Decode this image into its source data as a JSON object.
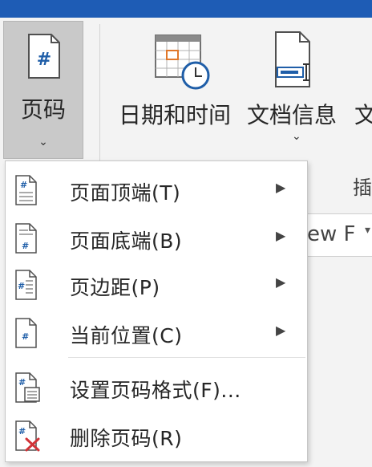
{
  "ribbon": {
    "page_number": {
      "label": "页码",
      "chevron": "⌄",
      "icon": "page-number-icon"
    },
    "date_time": {
      "label": "日期和时间",
      "icon": "calendar-clock-icon"
    },
    "doc_info": {
      "label": "文档信息",
      "chevron": "⌄",
      "icon": "document-info-icon"
    },
    "partial_button": {
      "label": "文"
    },
    "group_label": "插",
    "style_box": {
      "value": "ew F",
      "arrow": "▾"
    }
  },
  "menu": {
    "items": [
      {
        "label": "页面顶端(T)",
        "has_submenu": true,
        "arrow": "▶",
        "icon": "page-top-icon"
      },
      {
        "label": "页面底端(B)",
        "has_submenu": true,
        "arrow": "▶",
        "icon": "page-bottom-icon"
      },
      {
        "label": "页边距(P)",
        "has_submenu": true,
        "arrow": "▶",
        "icon": "page-margin-icon"
      },
      {
        "label": "当前位置(C)",
        "has_submenu": true,
        "arrow": "▶",
        "icon": "current-position-icon"
      },
      {
        "label": "设置页码格式(F)...",
        "has_submenu": false,
        "icon": "format-page-number-icon"
      },
      {
        "label": "删除页码(R)",
        "has_submenu": false,
        "icon": "remove-page-number-icon"
      }
    ]
  },
  "colors": {
    "title_strip": "#1e5cb5",
    "ribbon_bg": "#f3f3f3",
    "pressed_bg": "#c9c9c9",
    "icon_blue": "#1f5ea8",
    "delete_red": "#d13438",
    "calendar_orange": "#e0782b"
  }
}
